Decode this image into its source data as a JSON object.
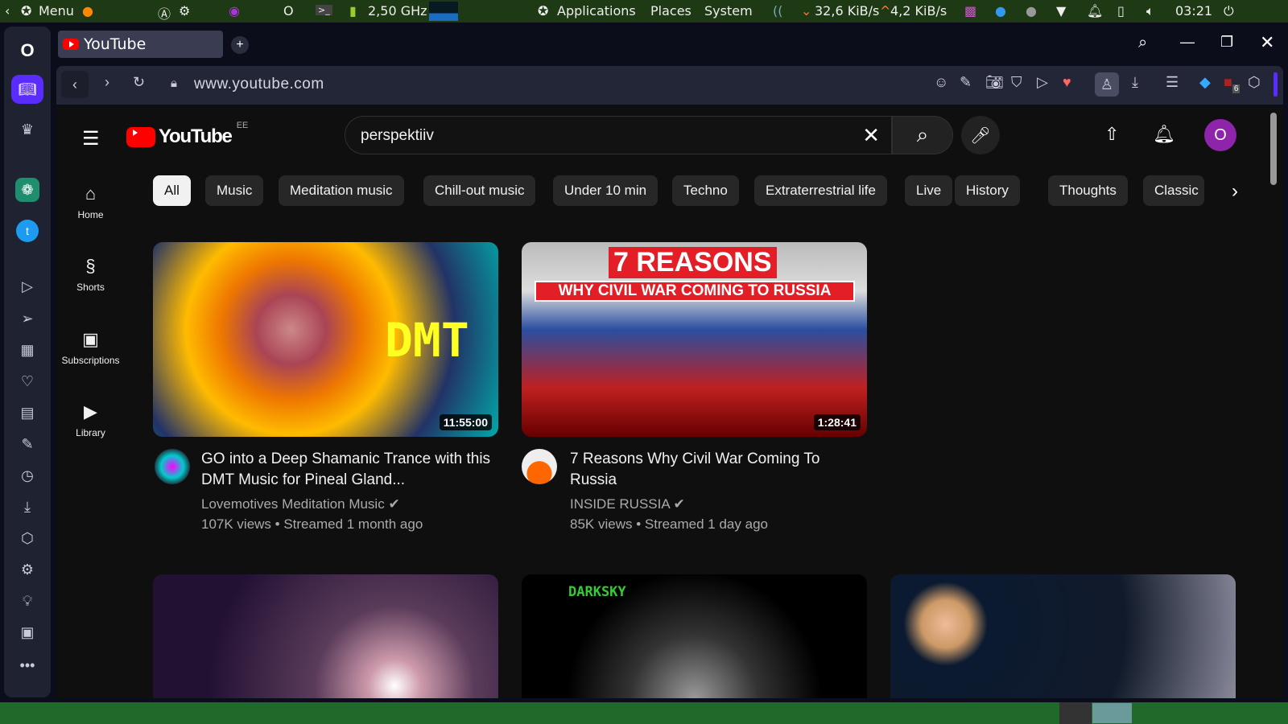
{
  "system_panel": {
    "menu": "Menu",
    "cpu": "2,50 GHz",
    "applications": "Applications",
    "places": "Places",
    "system": "System",
    "down_speed": "32,6 KiB/s",
    "up_speed": "4,2 KiB/s",
    "clock": "03:21"
  },
  "browser": {
    "tab_title": "YouTube",
    "url": "www.youtube.com",
    "extension_badge": "6"
  },
  "youtube": {
    "logo": "YouTube",
    "country": "EE",
    "search_value": "perspektiiv",
    "avatar_letter": "O",
    "nav": [
      {
        "label": "Home"
      },
      {
        "label": "Shorts"
      },
      {
        "label": "Subscriptions"
      },
      {
        "label": "Library"
      }
    ],
    "chips": [
      "All",
      "Music",
      "Meditation music",
      "Chill-out music",
      "Under 10 min",
      "Techno",
      "Extraterrestrial life",
      "Live",
      "History",
      "Thoughts",
      "Classic"
    ],
    "videos": [
      {
        "title": "GO into a Deep Shamanic Trance with this DMT Music for Pineal Gland...",
        "channel": "Lovemotives Meditation Music",
        "meta": "107K views • Streamed 1 month ago",
        "duration": "11:55:00",
        "thumb_text": "DMT"
      },
      {
        "title": "7 Reasons Why Civil War Coming To Russia",
        "channel": "INSIDE RUSSIA",
        "meta": "85K views • Streamed 1 day ago",
        "duration": "1:28:41",
        "thumb_text": "7 REASONS",
        "thumb_sub": "WHY CIVIL WAR COMING TO RUSSIA"
      }
    ],
    "row2_thumb_text": "DARKSKY"
  }
}
